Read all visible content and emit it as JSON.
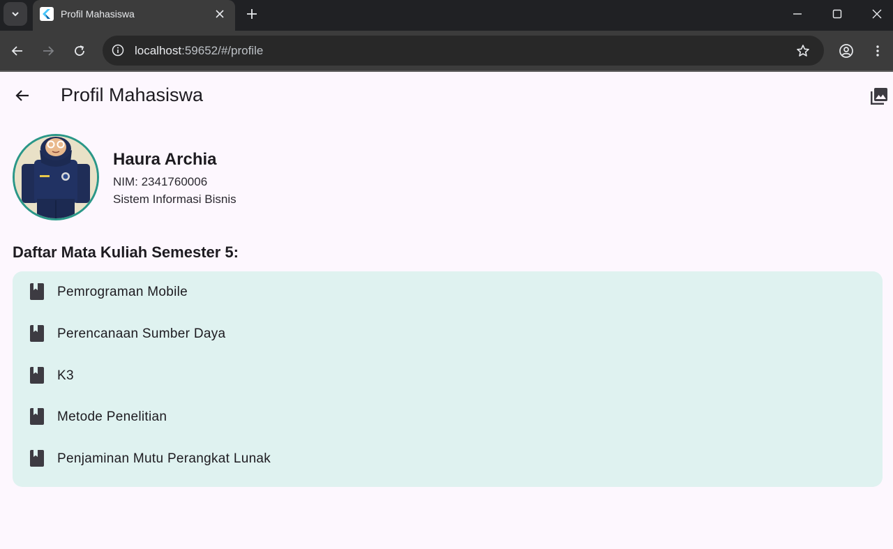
{
  "browser": {
    "tab_title": "Profil Mahasiswa",
    "url_host": "localhost",
    "url_rest": ":59652/#/profile"
  },
  "app": {
    "title": "Profil Mahasiswa"
  },
  "profile": {
    "name": "Haura Archia",
    "nim": "NIM: 2341760006",
    "prodi": "Sistem Informasi Bisnis"
  },
  "courses": {
    "title": "Daftar Mata Kuliah Semester 5:",
    "items": [
      {
        "label": "Pemrograman Mobile"
      },
      {
        "label": "Perencanaan Sumber Daya"
      },
      {
        "label": "K3"
      },
      {
        "label": "Metode Penelitian"
      },
      {
        "label": "Penjaminan Mutu Perangkat Lunak"
      }
    ]
  },
  "colors": {
    "page_bg": "#fdf7fe",
    "card_bg": "#dff2f0",
    "avatar_border": "#2a9788",
    "icon": "#3d3b42"
  },
  "icons": {
    "back": "arrow-left-icon",
    "gallery": "photo-library-icon",
    "course": "book-icon"
  }
}
